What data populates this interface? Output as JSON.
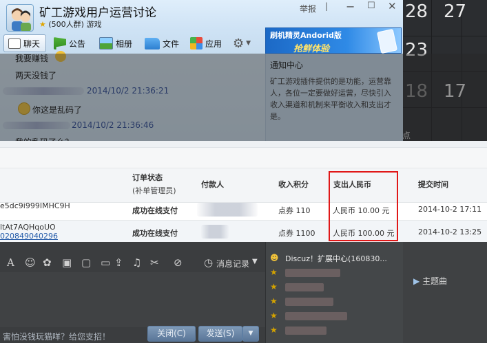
{
  "calendar": {
    "days": [
      "28",
      "27",
      "23",
      "18",
      "17"
    ],
    "fragment": "点"
  },
  "qq": {
    "title": "矿工游戏用户运营讨论",
    "subtitle_count": "(500人群)",
    "subtitle_tag": "游戏",
    "report": "举报",
    "toolbar": {
      "chat": "聊天",
      "notice": "公告",
      "album": "相册",
      "file": "文件",
      "app": "应用"
    },
    "banner": {
      "line1": "刷机精灵Andorid版",
      "line2": "抢鲜体验"
    },
    "messages": {
      "m1": "我要赚钱",
      "m2": "两天没钱了",
      "t1": "2014/10/2 21:36:21",
      "m3": "你这是乱码了",
      "t2": "2014/10/2 21:36:46",
      "m4": "我的乱码了么？"
    },
    "notice": {
      "title": "通知中心",
      "body": "矿工游戏插件提供的是功能，运营靠人，各位一定要做好运营，尽快引入收入渠道和机制来平衡收入和支出才是。"
    }
  },
  "table": {
    "headers": {
      "status": "订单状态",
      "status2": "(补单管理员)",
      "payer": "付款人",
      "income": "收入积分",
      "expense": "支出人民币",
      "time": "提交时间"
    },
    "rows": [
      {
        "order": "e5dc9i999IMHC9H",
        "order2": "",
        "status": "成功在线支付",
        "income": "点券 110",
        "expense": "人民币 10.00 元",
        "time": "2014-10-2 17:11"
      },
      {
        "order": "ltAt7AQHqoUO",
        "order2": "020849040296",
        "status": "成功在线支付",
        "income": "点券 1100",
        "expense": "人民币 100.00 元",
        "time": "2014-10-2 13:25"
      }
    ]
  },
  "bottom": {
    "msg_record": "消息记录",
    "message": "害怕没钱玩猫咩？给您支招！",
    "close": "关闭(C)",
    "send": "发送(S)",
    "discuz": "Discuz！扩展中心(160830...",
    "subject": "主题曲"
  },
  "colors": {
    "highlight": "#e01818",
    "link": "#2159a8",
    "banner": "#2f8ae6"
  }
}
